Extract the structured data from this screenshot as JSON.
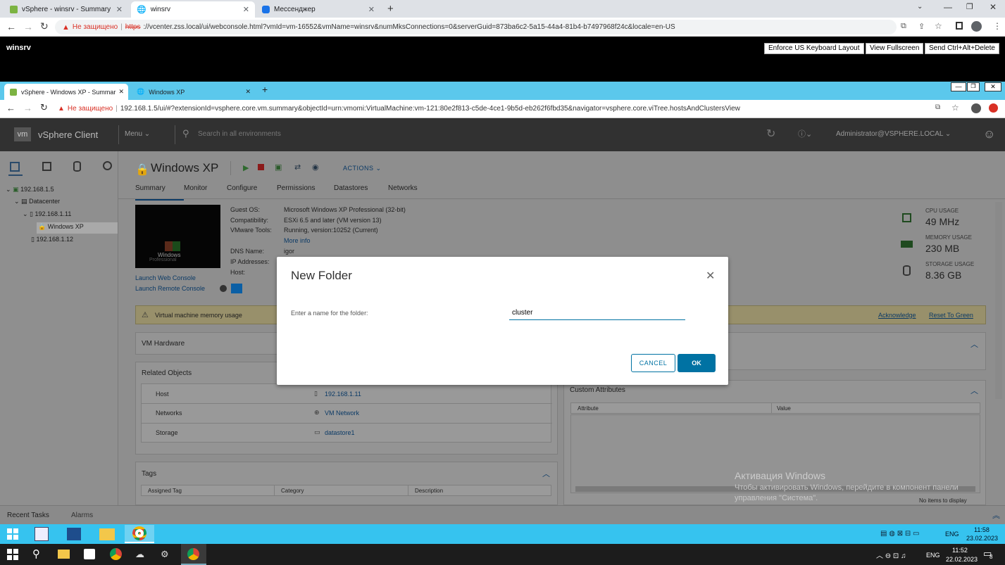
{
  "outer": {
    "tabs": [
      {
        "label": "vSphere - winsrv - Summary"
      },
      {
        "label": "winsrv"
      },
      {
        "label": "Мессенджер"
      }
    ],
    "not_secure": "Не защищено",
    "url_scheme": "https",
    "url_rest": "://vcenter.zss.local/ui/webconsole.html?vmId=vm-16552&vmName=winsrv&numMksConnections=0&serverGuid=873ba6c2-5a15-44a4-81b4-b7497968f24c&locale=en-US",
    "console_title": "winsrv",
    "buttons": {
      "keyboard": "Enforce US Keyboard Layout",
      "fullscreen": "View Fullscreen",
      "cad": "Send Ctrl+Alt+Delete"
    }
  },
  "inner": {
    "tabs": [
      {
        "label": "vSphere - Windows XP - Summar"
      },
      {
        "label": "Windows XP"
      }
    ],
    "not_secure": "Не защищено",
    "url": "192.168.1.5/ui/#?extensionId=vsphere.core.vm.summary&objectId=urn:vmomi:VirtualMachine:vm-121:80e2f813-c5de-4ce1-9b5d-eb262f6fbd35&navigator=vsphere.core.viTree.hostsAndClustersView"
  },
  "vsphere": {
    "logo": "vm",
    "app": "vSphere Client",
    "menu": "Menu",
    "search_placeholder": "Search in all environments",
    "user": "Administrator@VSPHERE.LOCAL",
    "tree": [
      "192.168.1.5",
      "Datacenter",
      "192.168.1.11",
      "Windows XP",
      "192.168.1.12"
    ],
    "vm_title": "Windows XP",
    "actions": "ACTIONS",
    "tabs": [
      "Summary",
      "Monitor",
      "Configure",
      "Permissions",
      "Datastores",
      "Networks"
    ],
    "info_labels": [
      "Guest OS:",
      "Compatibility:",
      "VMware Tools:",
      "",
      "DNS Name:",
      "IP Addresses:",
      "Host:"
    ],
    "info_values": [
      "Microsoft Windows XP Professional (32-bit)",
      "ESXi 6.5 and later (VM version 13)",
      "Running, version:10252 (Current)",
      "More info",
      "igor",
      "",
      ""
    ],
    "launch_web": "Launch Web Console",
    "launch_remote": "Launch Remote Console",
    "thumb_text": "Windows",
    "thumb_sub": "Professional",
    "stats": [
      {
        "label": "CPU USAGE",
        "value": "49 MHz"
      },
      {
        "label": "MEMORY USAGE",
        "value": "230 MB"
      },
      {
        "label": "STORAGE USAGE",
        "value": "8.36 GB"
      }
    ],
    "alert": "Virtual machine memory usage",
    "acknowledge": "Acknowledge",
    "reset": "Reset To Green",
    "vm_hardware": "VM Hardware",
    "related": "Related Objects",
    "related_rows": [
      {
        "k": "Host",
        "v": "192.168.1.11"
      },
      {
        "k": "Networks",
        "v": "VM Network"
      },
      {
        "k": "Storage",
        "v": "datastore1"
      }
    ],
    "tags": "Tags",
    "tag_cols": [
      "Assigned Tag",
      "Category",
      "Description"
    ],
    "custom": "Custom Attributes",
    "custom_cols": [
      "Attribute",
      "Value"
    ],
    "no_items": "No items to display",
    "recent_tasks": "Recent Tasks",
    "alarms": "Alarms",
    "watermark1": "Активация Windows",
    "watermark2": "Чтобы активировать Windows, перейдите в компонент панели",
    "watermark3": "управления \"Система\"."
  },
  "modal": {
    "title": "New Folder",
    "label": "Enter a name for the folder:",
    "value": "cluster",
    "cancel": "CANCEL",
    "ok": "OK"
  },
  "taskbar_inner": {
    "lang": "ENG",
    "time": "11:58",
    "date": "23.02.2023"
  },
  "taskbar_outer": {
    "lang": "ENG",
    "time": "11:52",
    "date": "22.02.2023",
    "notif": "8"
  },
  "colors": {
    "accent": "#0072a3",
    "inner_tab_bar": "#5bc8ec",
    "taskbar": "#36c3ef"
  }
}
